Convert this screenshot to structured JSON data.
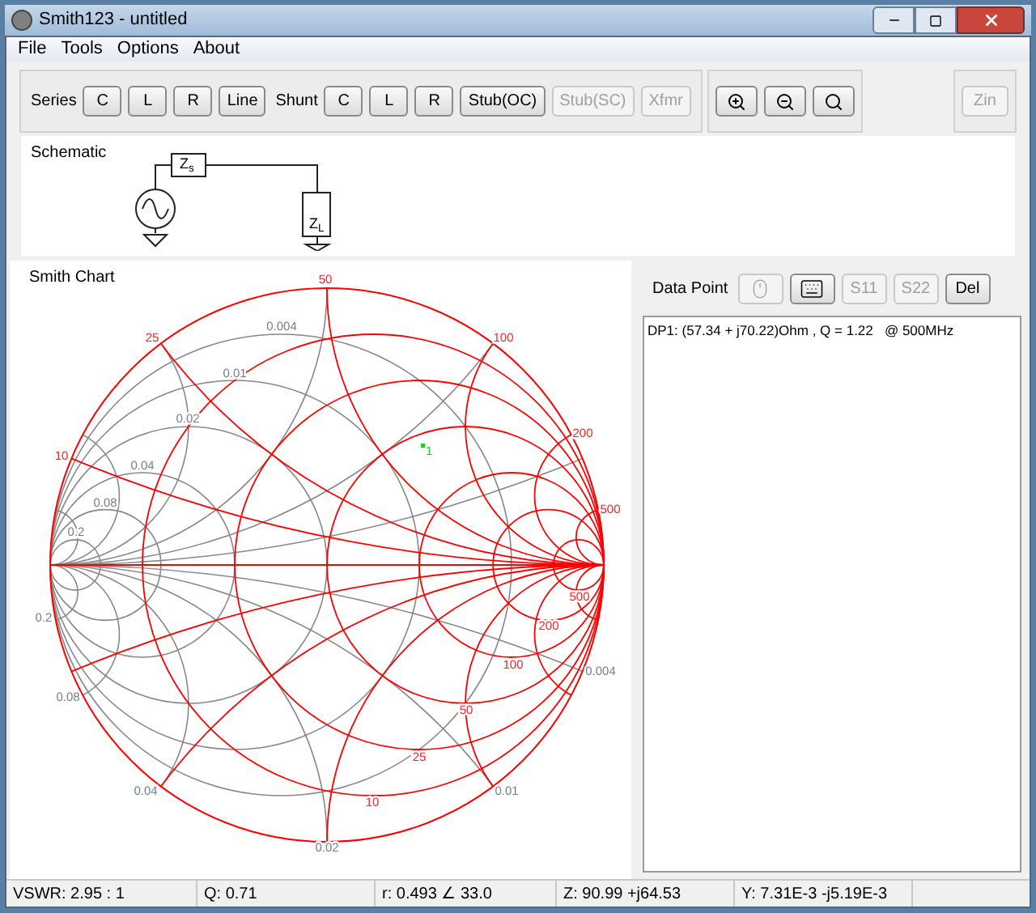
{
  "window": {
    "title": "Smith123 - untitled"
  },
  "menu": [
    "File",
    "Tools",
    "Options",
    "About"
  ],
  "toolbar": {
    "groups": [
      {
        "label": "Series",
        "buttons": [
          {
            "kind": "text",
            "text": "C",
            "disabled": false
          },
          {
            "kind": "text",
            "text": "L",
            "disabled": false
          },
          {
            "kind": "text",
            "text": "R",
            "disabled": false
          },
          {
            "kind": "text",
            "text": "Line",
            "disabled": false
          }
        ]
      },
      {
        "label": "Shunt",
        "buttons": [
          {
            "kind": "text",
            "text": "C",
            "disabled": false
          },
          {
            "kind": "text",
            "text": "L",
            "disabled": false
          },
          {
            "kind": "text",
            "text": "R",
            "disabled": false
          },
          {
            "kind": "text",
            "text": "Stub(OC)",
            "disabled": false
          },
          {
            "kind": "text",
            "text": "Stub(SC)",
            "disabled": true
          },
          {
            "kind": "text",
            "text": "Xfmr",
            "disabled": true
          }
        ]
      }
    ],
    "zoom_buttons": [
      {
        "kind": "zoom-in"
      },
      {
        "kind": "zoom-out"
      },
      {
        "kind": "zoom-fit"
      }
    ],
    "zin": {
      "kind": "text",
      "text": "Zin",
      "disabled": true
    }
  },
  "schematic": {
    "title": "Schematic",
    "source_label": "Z$_{s}$",
    "load_label": "Z$_{L}$"
  },
  "smith_chart": {
    "title": "Smith Chart",
    "labels": [
      {
        "text": "50",
        "kind": "impedance"
      },
      {
        "text": "25",
        "kind": "impedance"
      },
      {
        "text": "100",
        "kind": "impedance"
      },
      {
        "text": "10",
        "kind": "impedance"
      },
      {
        "text": "200",
        "kind": "impedance"
      },
      {
        "text": "500",
        "kind": "impedance"
      },
      {
        "text": "500",
        "kind": "impedance"
      },
      {
        "text": "200",
        "kind": "impedance"
      },
      {
        "text": "100",
        "kind": "impedance"
      },
      {
        "text": "50",
        "kind": "impedance"
      },
      {
        "text": "25",
        "kind": "impedance"
      },
      {
        "text": "10",
        "kind": "impedance"
      },
      {
        "text": "0.004",
        "kind": "admittance"
      },
      {
        "text": "0.01",
        "kind": "admittance"
      },
      {
        "text": "0.02",
        "kind": "admittance"
      },
      {
        "text": "0.04",
        "kind": "admittance"
      },
      {
        "text": "0.08",
        "kind": "admittance"
      },
      {
        "text": "0.2",
        "kind": "admittance"
      },
      {
        "text": "0.2",
        "kind": "admittance"
      },
      {
        "text": "0.08",
        "kind": "admittance"
      },
      {
        "text": "0.04",
        "kind": "admittance"
      },
      {
        "text": "0.02",
        "kind": "admittance"
      },
      {
        "text": "0.01",
        "kind": "admittance"
      },
      {
        "text": "0.004",
        "kind": "admittance"
      }
    ],
    "points": [
      {
        "label": "1",
        "color": "#22cc22"
      }
    ]
  },
  "data_point": {
    "label": "Data Point",
    "buttons": [
      {
        "kind": "mouse",
        "disabled": true
      },
      {
        "kind": "keyboard",
        "disabled": false
      },
      {
        "kind": "text",
        "text": "S11",
        "disabled": true
      },
      {
        "kind": "text",
        "text": "S22",
        "disabled": true
      },
      {
        "kind": "text",
        "text": "Del",
        "disabled": false
      }
    ],
    "entries": [
      "DP1: (57.34 + j70.22)Ohm , Q = 1.22   @ 500MHz"
    ]
  },
  "status_bar": [
    "VSWR: 2.95 : 1",
    "Q: 0.71",
    "r: 0.493 ∠ 33.0",
    "Z: 90.99 +j64.53",
    "Y: 7.31E-3 -j5.19E-3"
  ]
}
